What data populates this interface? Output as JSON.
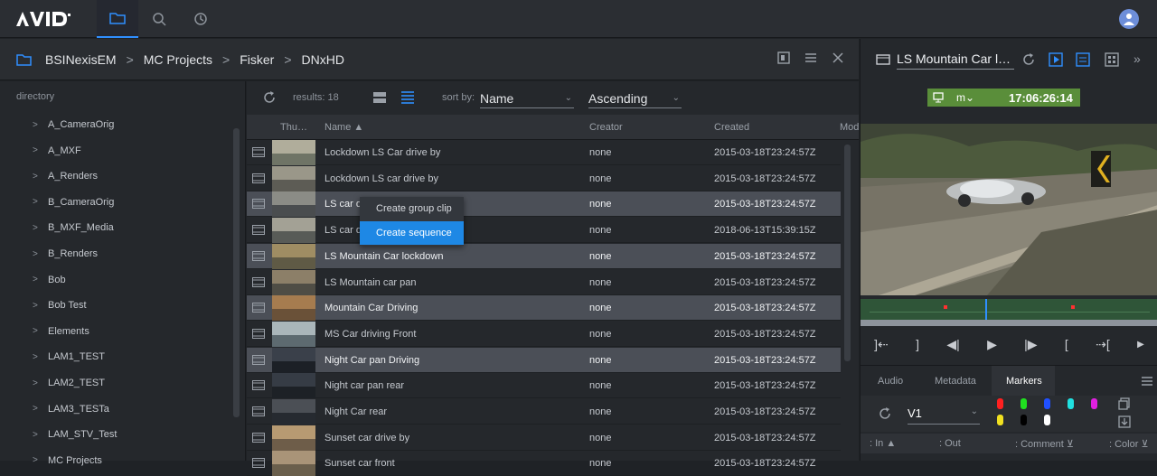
{
  "app": {
    "logo_text": "AVID"
  },
  "breadcrumb": [
    "BSINexisEM",
    "MC Projects",
    "Fisker",
    "DNxHD"
  ],
  "directory": {
    "title": "directory",
    "items": [
      "A_CameraOrig",
      "A_MXF",
      "A_Renders",
      "B_CameraOrig",
      "B_MXF_Media",
      "B_Renders",
      "Bob",
      "Bob Test",
      "Elements",
      "LAM1_TEST",
      "LAM2_TEST",
      "LAM3_TESTa",
      "LAM_STV_Test",
      "MC Projects"
    ]
  },
  "list": {
    "results": "results: 18",
    "sort_label": "sort by:",
    "sort_field": "Name",
    "sort_order": "Ascending",
    "columns": {
      "thumb": "Thu…",
      "name": "Name",
      "creator": "Creator",
      "created": "Created",
      "mod": "Mod"
    },
    "rows": [
      {
        "name": "Lockdown LS Car drive by",
        "creator": "none",
        "created": "2015-03-18T23:24:57Z",
        "selected": false
      },
      {
        "name": "Lockdown LS car drive by",
        "creator": "none",
        "created": "2015-03-18T23:24:57Z",
        "selected": false
      },
      {
        "name": "LS car d",
        "creator": "none",
        "created": "2015-03-18T23:24:57Z",
        "selected": true
      },
      {
        "name": "LS car d",
        "creator": "none",
        "created": "2018-06-13T15:39:15Z",
        "selected": false
      },
      {
        "name": "LS Mountain Car lockdown",
        "creator": "none",
        "created": "2015-03-18T23:24:57Z",
        "selected": true
      },
      {
        "name": "LS Mountain car pan",
        "creator": "none",
        "created": "2015-03-18T23:24:57Z",
        "selected": false
      },
      {
        "name": "Mountain Car Driving",
        "creator": "none",
        "created": "2015-03-18T23:24:57Z",
        "selected": true
      },
      {
        "name": "MS Car driving Front",
        "creator": "none",
        "created": "2015-03-18T23:24:57Z",
        "selected": false
      },
      {
        "name": "Night Car pan Driving",
        "creator": "none",
        "created": "2015-03-18T23:24:57Z",
        "selected": true
      },
      {
        "name": "Night car pan rear",
        "creator": "none",
        "created": "2015-03-18T23:24:57Z",
        "selected": false
      },
      {
        "name": "Night Car rear",
        "creator": "none",
        "created": "2015-03-18T23:24:57Z",
        "selected": false
      },
      {
        "name": "Sunset car drive by",
        "creator": "none",
        "created": "2015-03-18T23:24:57Z",
        "selected": false
      },
      {
        "name": "Sunset car front",
        "creator": "none",
        "created": "2015-03-18T23:24:57Z",
        "selected": false
      }
    ]
  },
  "context_menu": {
    "items": [
      "Create group clip",
      "Create sequence"
    ]
  },
  "viewer": {
    "title": "LS Mountain Car l…",
    "tc_mode": "m",
    "timecode": "17:06:26:14",
    "tabs": [
      "Audio",
      "Metadata",
      "Markers"
    ],
    "track": "V1",
    "columns": {
      "in": ": In",
      "out": ": Out",
      "comment": ": Comment",
      "color": ": Color"
    }
  },
  "colors": {
    "accent": "#1e88e5",
    "timecode_bg": "#5a8e3a"
  }
}
